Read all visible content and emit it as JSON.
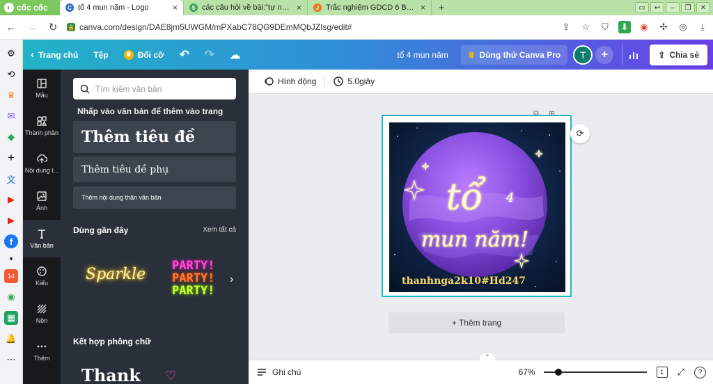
{
  "browser": {
    "brand": "cốc cốc",
    "tabs": [
      {
        "title": "tổ 4 mun năm - Logo",
        "close": "×",
        "favicon": "C"
      },
      {
        "title": "các câu hỏi về bài:\"tự nhận th",
        "close": "×",
        "favicon": "S"
      },
      {
        "title": "Trắc nghiệm GDCD 6 Bài 6 (c",
        "close": "×",
        "favicon": "J"
      }
    ],
    "new_tab": "+",
    "url": "canva.com/design/DAE8jm5UWGM/mPXabC78QG9DEmMQbJZIsg/edit#"
  },
  "browser_sidebar": {
    "icons": [
      "gear-icon",
      "history-icon",
      "crown-icon",
      "messenger-icon",
      "game-icon",
      "add-icon",
      "translate-icon",
      "youtube-icon",
      "youtube-icon",
      "facebook-icon",
      "more-icon",
      "calendar-icon",
      "maps-icon",
      "sheets-icon",
      "bell-icon",
      "more-dots-icon"
    ],
    "calendar_day": "14"
  },
  "canva_top": {
    "home": "Trang chủ",
    "file": "Tệp",
    "resize": "Đổi cỡ",
    "doc_title": "tổ 4 mun năm",
    "try_pro": "Dùng thử Canva Pro",
    "avatar_letter": "T",
    "share": "Chia sẻ"
  },
  "rail": [
    {
      "label": "Mẫu",
      "icon": "templates-icon"
    },
    {
      "label": "Thành phần",
      "icon": "elements-icon"
    },
    {
      "label": "Nội dung t...",
      "icon": "upload-icon"
    },
    {
      "label": "Ảnh",
      "icon": "photos-icon"
    },
    {
      "label": "Văn bản",
      "icon": "text-icon"
    },
    {
      "label": "Kiểu",
      "icon": "styles-icon"
    },
    {
      "label": "Nền",
      "icon": "background-icon"
    },
    {
      "label": "Thêm",
      "icon": "more-icon"
    }
  ],
  "text_panel": {
    "search_placeholder": "Tìm kiếm văn bản",
    "hint": "Nhấp vào văn bản để thêm vào trang",
    "heading": "Thêm tiêu đề",
    "subheading": "Thêm tiêu đề phụ",
    "body": "Thêm nội dung thân văn bản",
    "recent_title": "Dùng gần đây",
    "see_all": "Xem tất cả",
    "recent_sparkle": "Sparkle",
    "recent_party": [
      "PARTY!",
      "PARTY!",
      "PARTY!"
    ],
    "combo_title": "Kết hợp phông chữ",
    "combo_preview": "Thank"
  },
  "editor": {
    "animate": "Hình động",
    "duration": "5.0giây",
    "design_text_main": "tổ",
    "design_text_num": "4",
    "design_text_sub": "mun năm!",
    "design_watermark": "thanhnga2k10#Hd247",
    "add_page": "+ Thêm trang",
    "notes": "Ghi chú",
    "zoom": "67%",
    "zoom_level": 0.12,
    "page_count": "1",
    "help": "?"
  }
}
